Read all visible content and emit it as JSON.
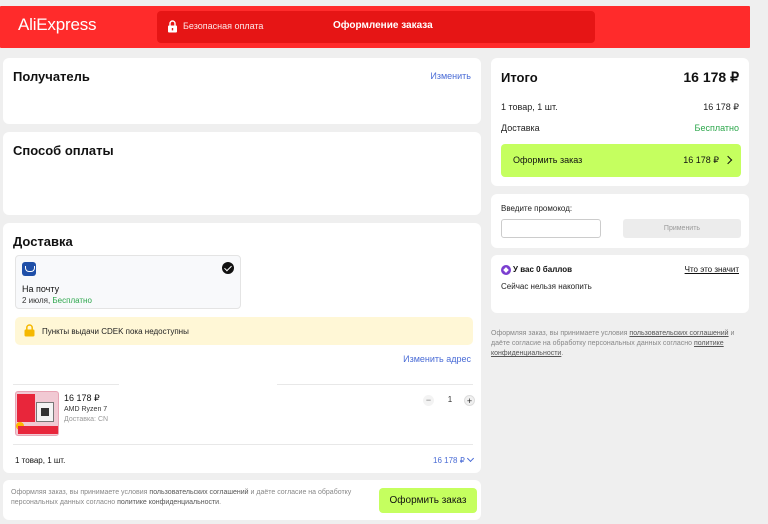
{
  "header": {
    "logo": "AliExpress",
    "secure_label": "Безопасная оплата",
    "title": "Оформление заказа",
    "brand_color": "#ff2b2b",
    "lock_icon": "lock-icon"
  },
  "recipient": {
    "title": "Получатель",
    "edit_label": "Изменить"
  },
  "payment": {
    "title": "Способ оплаты"
  },
  "delivery": {
    "title": "Доставка",
    "option": {
      "icon": "russian-post-icon",
      "name": "На почту",
      "date": "2 июля,",
      "price": "Бесплатно",
      "selected": true
    },
    "notice": "Пункты выдачи CDEK пока недоступны",
    "change_address": "Изменить адрес",
    "product": {
      "price": "16 178 ₽",
      "name": "AMD Ryzen 7",
      "shipping": "Доставка: CN",
      "quantity": "1",
      "minus": "−",
      "plus": "+"
    },
    "summary_label": "1 товар, 1 шт.",
    "summary_price": "16 178 ₽"
  },
  "bottom_bar": {
    "legal_prefix": "Оформляя заказ, вы принимаете условия",
    "legal_link1": "пользовательских соглашений",
    "legal_mid": "и даёте согласие на обработку персональных данных согласно",
    "legal_link2": "политике конфиденциальности",
    "legal_end": ".",
    "order_button": "Оформить заказ"
  },
  "total": {
    "title": "Итого",
    "value": "16 178 ₽",
    "items_label": "1 товар, 1 шт.",
    "items_value": "16 178 ₽",
    "delivery_label": "Доставка",
    "delivery_value": "Бесплатно",
    "order_button_label": "Оформить заказ",
    "order_button_value": "16 178 ₽",
    "button_color": "#c5ff5f"
  },
  "promo": {
    "label": "Введите промокод:",
    "input_value": "",
    "input_placeholder": "",
    "apply_button": "Применить"
  },
  "points": {
    "title": "У вас 0 баллов",
    "link": "Что это значит",
    "subtitle": "Сейчас нельзя накопить"
  },
  "side_legal": {
    "prefix": "Оформляя заказ, вы принимаете условия",
    "link1": "пользовательских соглашений",
    "mid": "и даёте согласие на обработку персональных данных согласно",
    "link2": "политике конфиденциальности",
    "end": "."
  }
}
